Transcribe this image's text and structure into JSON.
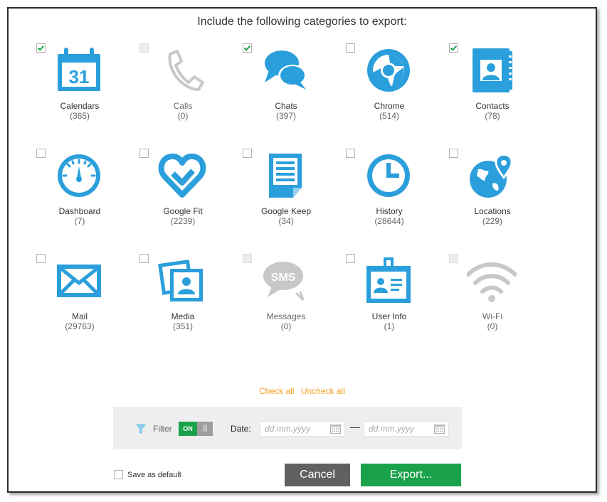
{
  "dialog": {
    "heading": "Include the following categories to export:"
  },
  "colors": {
    "accent": "#2b9fdb",
    "disabled": "#c8c8c8",
    "link": "#f0a020",
    "green": "#1aa24b"
  },
  "categories": [
    {
      "name": "Calendars",
      "count": "(365)",
      "checked": true,
      "enabled": true,
      "icon": "calendar-icon"
    },
    {
      "name": "Calls",
      "count": "(0)",
      "checked": false,
      "enabled": false,
      "icon": "phone-icon"
    },
    {
      "name": "Chats",
      "count": "(397)",
      "checked": true,
      "enabled": true,
      "icon": "chat-bubbles-icon"
    },
    {
      "name": "Chrome",
      "count": "(514)",
      "checked": false,
      "enabled": true,
      "icon": "chrome-icon"
    },
    {
      "name": "Contacts",
      "count": "(78)",
      "checked": true,
      "enabled": true,
      "icon": "contacts-book-icon"
    },
    {
      "name": "Dashboard",
      "count": "(7)",
      "checked": false,
      "enabled": true,
      "icon": "gauge-icon"
    },
    {
      "name": "Google Fit",
      "count": "(2239)",
      "checked": false,
      "enabled": true,
      "icon": "heart-icon"
    },
    {
      "name": "Google Keep",
      "count": "(34)",
      "checked": false,
      "enabled": true,
      "icon": "note-icon"
    },
    {
      "name": "History",
      "count": "(28644)",
      "checked": false,
      "enabled": true,
      "icon": "clock-icon"
    },
    {
      "name": "Locations",
      "count": "(229)",
      "checked": false,
      "enabled": true,
      "icon": "globe-pin-icon"
    },
    {
      "name": "Mail",
      "count": "(29763)",
      "checked": false,
      "enabled": true,
      "icon": "envelope-icon"
    },
    {
      "name": "Media",
      "count": "(351)",
      "checked": false,
      "enabled": true,
      "icon": "photos-icon"
    },
    {
      "name": "Messages",
      "count": "(0)",
      "checked": false,
      "enabled": false,
      "icon": "sms-icon",
      "icon_text": "SMS"
    },
    {
      "name": "User Info",
      "count": "(1)",
      "checked": false,
      "enabled": true,
      "icon": "id-badge-icon"
    },
    {
      "name": "Wi-Fi",
      "count": "(0)",
      "checked": false,
      "enabled": false,
      "icon": "wifi-icon"
    }
  ],
  "links": {
    "check_all": "Check all",
    "uncheck_all": "Uncheck all"
  },
  "filter": {
    "label": "Filter",
    "toggle_on": "ON",
    "toggle_off": "|||",
    "date_label": "Date:",
    "date_from_placeholder": "dd.mm.yyyy",
    "date_to_placeholder": "dd.mm.yyyy",
    "separator": "—"
  },
  "footer": {
    "save_default_label": "Save as default",
    "cancel_label": "Cancel",
    "export_label": "Export..."
  }
}
